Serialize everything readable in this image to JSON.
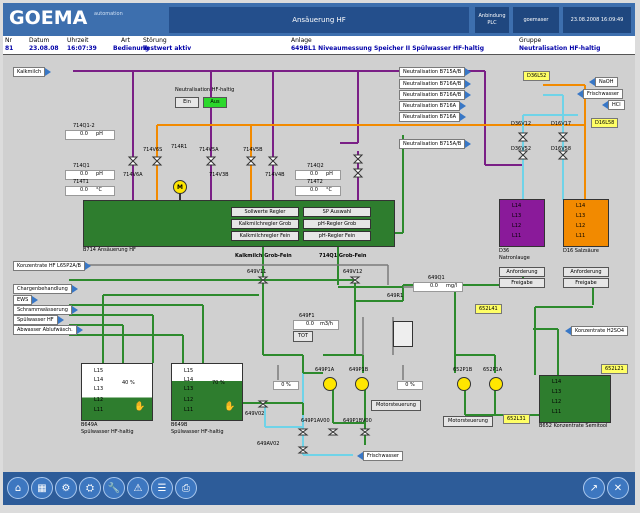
{
  "header": {
    "logo": "GOEMA",
    "logo_sub": "automation",
    "title": "Ansäuerung HF",
    "btn_plc": "Anbindung PLC",
    "btn_user": "goemaser",
    "datetime": "23.08.2008 16:09:49"
  },
  "messages": {
    "columns": [
      "Nr",
      "Datum",
      "Uhrzeit",
      "Art",
      "Störung",
      "Anlage",
      "Gruppe"
    ],
    "row": [
      "81",
      "23.08.08",
      "16:07:39",
      "Bedienung",
      "Testwert aktiv",
      "649BL1 Niveaumessung Speicher II Spülwasser HF-haltig",
      "Neutralisation HF-haltig"
    ]
  },
  "tags": {
    "kalkmilch": "Kalkmilch",
    "neutr_a": "Neutralisation B715A/B",
    "neutr_b": "Neutralisation B716A/B",
    "neutr_c": "Neutralisation B716A/B",
    "neutr_d": "Neutralisation B716A",
    "neutr_e": "Neutralisation B716A",
    "neutr_f": "Neutralisation B715A/B",
    "naoh": "NaOH",
    "frischwasser_top": "Frischwasser",
    "hcl": "HCl",
    "konz_hf": "Konzentrate HF L65P2A/B",
    "chargen": "Chargenbehandlung",
    "ews": "EWS",
    "schramm": "Schrammwässerung",
    "spuel_hf": "Spülwasser HF",
    "abwasser": "Abwasser Ablufwäsch.",
    "konz_h2so4": "Konzentrate H2SO4",
    "frischwasser_bottom": "Frischwasser"
  },
  "neutral_ctrl": {
    "title": "Neutralisation HF-haltig",
    "ein": "Ein",
    "aus": "Aus"
  },
  "measure": {
    "m1_tag": "714Q1-2",
    "m1_val": "0.0",
    "m1_unit": "pH",
    "m2_tag": "714Q1",
    "m2_val": "0.0",
    "m2_unit": "pH",
    "m3_tag": "714T1",
    "m3_val": "0.0",
    "m3_unit": "°C",
    "m4_tag": "714Q2",
    "m4_val": "0.0",
    "m4_unit": "pH",
    "m5_tag": "714T2",
    "m5_val": "0.0",
    "m5_unit": "°C",
    "m6_tag": "649Q1",
    "m6_val": "0.0",
    "m6_unit": "mg/l",
    "m7_tag": "649F1",
    "m7_val": "0.0",
    "m7_unit": "m3/h"
  },
  "valves": {
    "v1": "714V6B",
    "v2": "714V6A",
    "v3": "714V5A",
    "v4": "714V5B",
    "v5": "714V4B",
    "v6": "714V3B",
    "v7": "714V6S",
    "v8": "649V11",
    "v9": "649V12",
    "v10": "649R1",
    "v11": "649V02",
    "v12": "649P1A",
    "v13": "649P1B",
    "v14": "649P1AV00",
    "v15": "649P1BV00",
    "v16": "649AV02",
    "v17": "652P1B",
    "v18": "652P1A",
    "v19": "D36V12",
    "v20": "D16V17",
    "v21": "D36V52",
    "v22": "D16V58"
  },
  "agitator": "714R1",
  "reactor": {
    "label": "B714 Ansäuerung HF",
    "status": "Kalkmilch Grob-Fein",
    "status2": "714Q1 Grob-Fein"
  },
  "controllers": {
    "c1": "Sollwerte Regler",
    "c2": "SP Auswahl",
    "c3": "Kalkmilchregler Grob",
    "c4": "pH-Regler Grob",
    "c5": "Kalkmilchregler Fein",
    "c6": "pH-Regler Fein"
  },
  "badges": {
    "b1": "D36L52",
    "b2": "D16L58",
    "b3": "652L41",
    "b4": "652L21",
    "b5": "652L31"
  },
  "buttons": {
    "tot": "TOT",
    "motor1": "Motorsteuerung",
    "motor2": "Motorsteuerung",
    "anf1": "Anforderung",
    "frei1": "Freigabe",
    "anf2": "Anforderung",
    "frei2": "Freigabe"
  },
  "pct": {
    "p1": "0 %",
    "p2": "0 %",
    "p3": "0 %"
  },
  "tank_natron": {
    "label": "D36",
    "label2": "Natronlauge",
    "levels": [
      "L14",
      "L13",
      "L12",
      "L11"
    ]
  },
  "tank_salz": {
    "label": "D16 Salzsäure",
    "levels": [
      "L14",
      "L13",
      "L12",
      "L11"
    ]
  },
  "tank_b649a": {
    "label": "B649A",
    "label2": "Spülwasser HF-haltig",
    "levels": [
      "L15",
      "L14",
      "L13",
      "L12",
      "L11"
    ],
    "pct": "40 %"
  },
  "tank_b649b": {
    "label": "B649B",
    "label2": "Spülwasser HF-haltig",
    "levels": [
      "L15",
      "L14",
      "L13",
      "L12",
      "L11"
    ],
    "pct": "70 %"
  },
  "tank_b652": {
    "label": "B652 Konzentrate Semitool",
    "levels": [
      "L14",
      "L13",
      "L12",
      "L11"
    ]
  },
  "colors": {
    "green": "#2e7d2e",
    "purple": "#8a1a9a",
    "orange": "#f28a00",
    "blue": "#3877c6",
    "cyan": "#6fd3e8",
    "pipe_purple": "#7a1f86",
    "pipe_green": "#2d8a2d"
  }
}
